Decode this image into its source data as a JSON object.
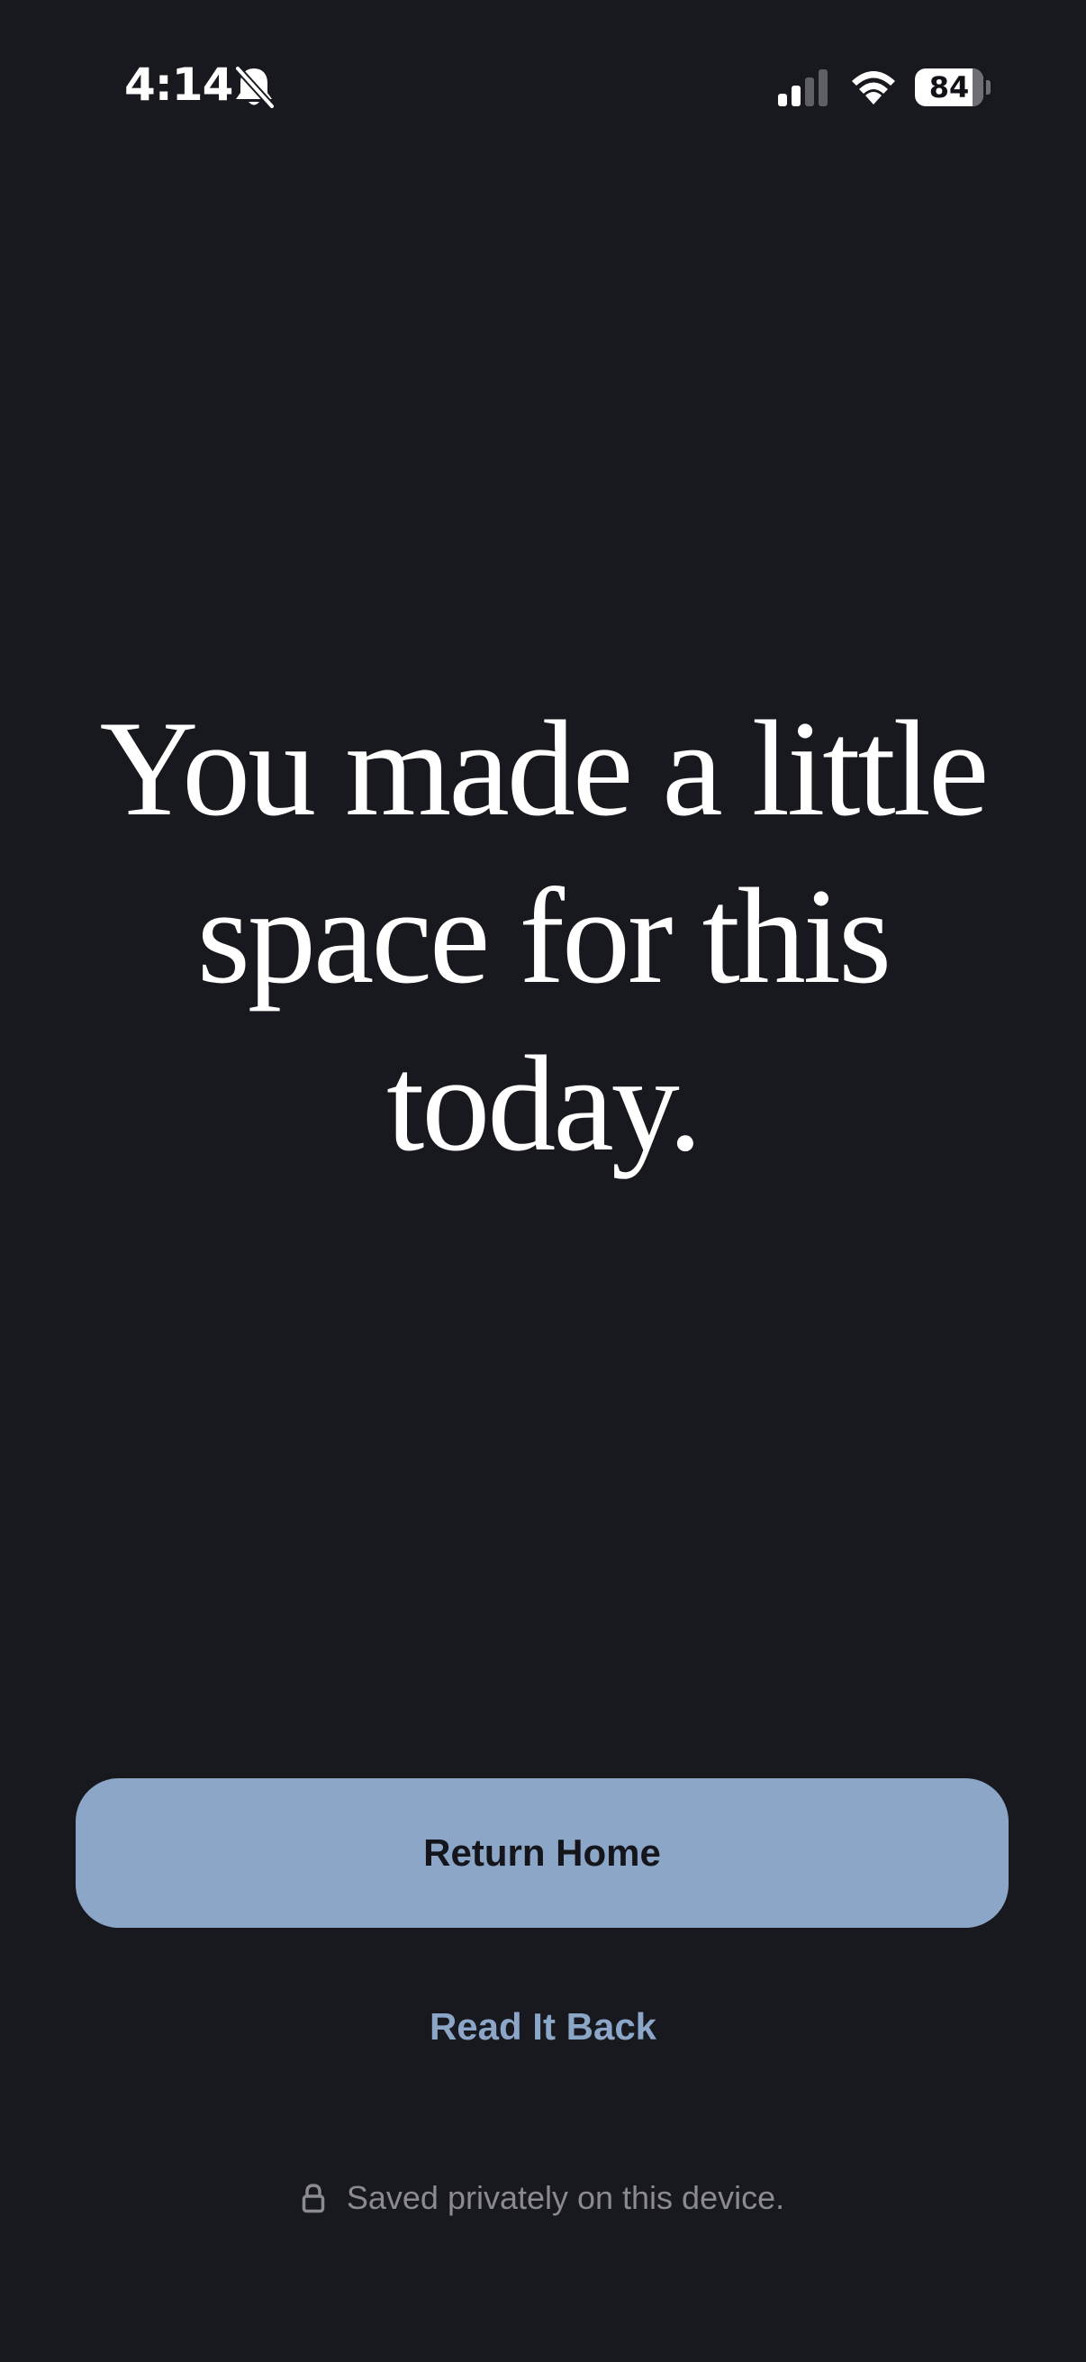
{
  "status_bar": {
    "time": "4:14",
    "battery_level": "84",
    "battery_percent": 84,
    "silent_mode_icon": "bell-slash-icon",
    "signal_icon": "cellular-signal-icon",
    "wifi_icon": "wifi-icon"
  },
  "main": {
    "message": "You made a little space for this today."
  },
  "actions": {
    "return_home_label": "Return Home",
    "read_back_label": "Read It Back"
  },
  "footer": {
    "lock_icon": "lock-icon",
    "privacy_note": "Saved privately on this device."
  },
  "colors": {
    "background": "#18181f",
    "accent": "#8ca6c7",
    "text_primary": "#ffffff",
    "text_muted": "#8a8a90"
  }
}
